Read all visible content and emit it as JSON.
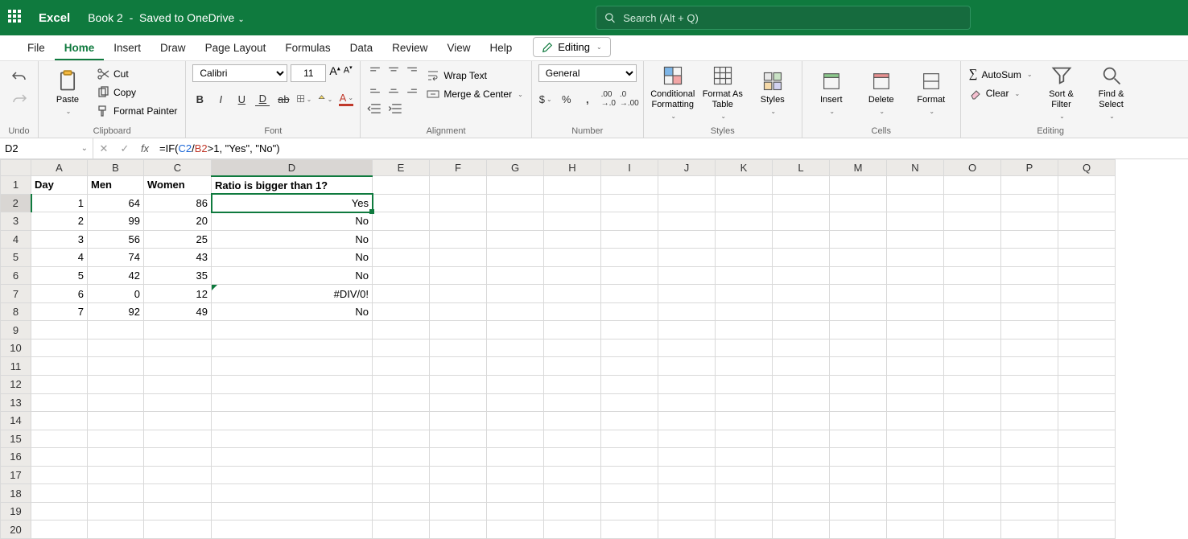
{
  "app": {
    "name": "Excel",
    "doc": "Book 2",
    "saved": "Saved to OneDrive"
  },
  "search": {
    "placeholder": "Search (Alt + Q)"
  },
  "tabs": {
    "items": [
      "File",
      "Home",
      "Insert",
      "Draw",
      "Page Layout",
      "Formulas",
      "Data",
      "Review",
      "View",
      "Help"
    ],
    "active": 1,
    "editing": "Editing"
  },
  "ribbon": {
    "undo": "Undo",
    "clipboard": {
      "label": "Clipboard",
      "paste": "Paste",
      "cut": "Cut",
      "copy": "Copy",
      "painter": "Format Painter"
    },
    "font": {
      "label": "Font",
      "name": "Calibri",
      "size": "11"
    },
    "alignment": {
      "label": "Alignment",
      "wrap": "Wrap Text",
      "merge": "Merge & Center"
    },
    "number": {
      "label": "Number",
      "format": "General"
    },
    "styles": {
      "label": "Styles",
      "cond": "Conditional Formatting",
      "table": "Format As Table",
      "styles": "Styles"
    },
    "cells": {
      "label": "Cells",
      "insert": "Insert",
      "delete": "Delete",
      "format": "Format"
    },
    "editing": {
      "label": "Editing",
      "autosum": "AutoSum",
      "clear": "Clear",
      "sort": "Sort & Filter",
      "find": "Find & Select"
    }
  },
  "namebox": "D2",
  "formula": {
    "pre": "=IF(",
    "ref1": "C2",
    "mid": "/",
    "ref2": "B2",
    "post": ">1, \"Yes\", \"No\")"
  },
  "cols": [
    "A",
    "B",
    "C",
    "D",
    "E",
    "F",
    "G",
    "H",
    "I",
    "J",
    "K",
    "L",
    "M",
    "N",
    "O",
    "P",
    "Q"
  ],
  "headers": {
    "A": "Day",
    "B": "Men",
    "C": "Women",
    "D": "Ratio is bigger than 1?"
  },
  "rows": [
    {
      "A": "1",
      "B": "64",
      "C": "86",
      "D": "Yes"
    },
    {
      "A": "2",
      "B": "99",
      "C": "20",
      "D": "No"
    },
    {
      "A": "3",
      "B": "56",
      "C": "25",
      "D": "No"
    },
    {
      "A": "4",
      "B": "74",
      "C": "43",
      "D": "No"
    },
    {
      "A": "5",
      "B": "42",
      "C": "35",
      "D": "No"
    },
    {
      "A": "6",
      "B": "0",
      "C": "12",
      "D": "#DIV/0!"
    },
    {
      "A": "7",
      "B": "92",
      "C": "49",
      "D": "No"
    }
  ],
  "totalRows": 20,
  "selectedCell": "D2",
  "selectedCol": "D",
  "selectedRow": 2
}
